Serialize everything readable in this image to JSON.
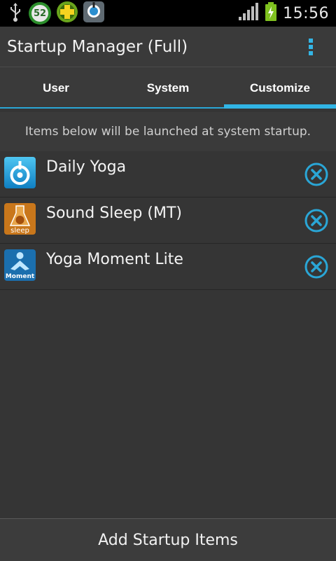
{
  "status_bar": {
    "badge_count": "52",
    "time": "15:56",
    "icons": [
      "usb-icon",
      "counter-badge-icon",
      "plus-app-icon",
      "location-app-icon",
      "signal-icon",
      "battery-charging-icon"
    ]
  },
  "app": {
    "title": "Startup Manager (Full)"
  },
  "tabs": [
    {
      "label": "User"
    },
    {
      "label": "System"
    },
    {
      "label": "Customize"
    }
  ],
  "banner": "Items below will be launched at system startup.",
  "items": [
    {
      "label": "Daily Yoga"
    },
    {
      "label": "Sound Sleep (MT)"
    },
    {
      "label": "Yoga Moment Lite"
    }
  ],
  "item_icon_text": [
    "sleep",
    "Moment"
  ],
  "footer": {
    "button_label": "Add Startup Items"
  },
  "colors": {
    "accent": "#31b5e5"
  }
}
